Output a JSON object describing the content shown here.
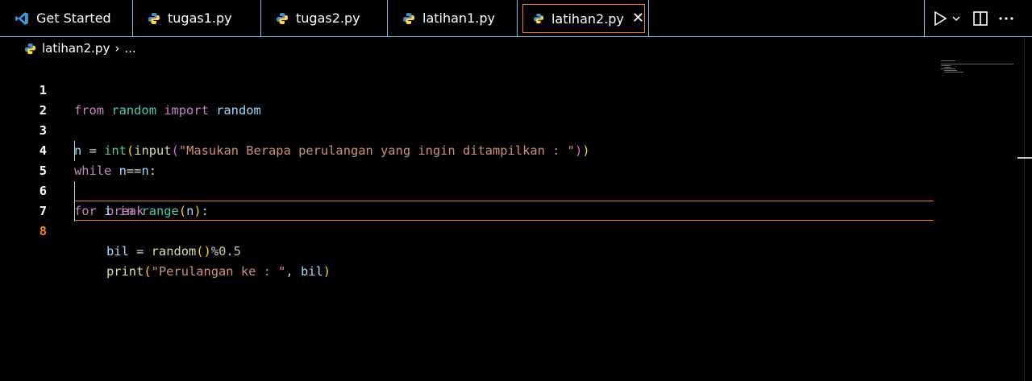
{
  "tabs": [
    {
      "label": "Get Started",
      "icon": "vscode-logo-icon"
    },
    {
      "label": "tugas1.py",
      "icon": "python-icon"
    },
    {
      "label": "tugas2.py",
      "icon": "python-icon"
    },
    {
      "label": "latihan1.py",
      "icon": "python-icon"
    },
    {
      "label": "latihan2.py",
      "icon": "python-icon",
      "active": true,
      "close": "✕"
    }
  ],
  "actions": {
    "run": "run-icon",
    "dropdown": "chevron-down-icon",
    "split": "split-editor-icon",
    "more": "more-icon"
  },
  "breadcrumb": {
    "file": "latihan2.py",
    "separator": "›",
    "rest": "..."
  },
  "editor": {
    "lines": [
      {
        "n": "1"
      },
      {
        "n": "2"
      },
      {
        "n": "3"
      },
      {
        "n": "4"
      },
      {
        "n": "5"
      },
      {
        "n": "6"
      },
      {
        "n": "7"
      },
      {
        "n": "8"
      }
    ],
    "code": {
      "l1": [
        "from",
        "random",
        "import",
        "random"
      ],
      "l3": [
        "n",
        "=",
        "int",
        "(",
        "input",
        "(",
        "\"Masukan Berapa perulangan yang ingin ditampilkan : \"",
        ")",
        ")"
      ],
      "l4": [
        "while",
        "n",
        "==",
        "n",
        ":"
      ],
      "l5": [
        "break"
      ],
      "l6": [
        "for",
        "i",
        "in",
        "range",
        "(",
        "n",
        ")",
        ":"
      ],
      "l7": [
        "bil",
        "=",
        "random",
        "()",
        "%",
        "0.5"
      ],
      "l8": [
        "print",
        "(",
        "\"Perulangan ke : \"",
        ",",
        "bil",
        ")"
      ]
    },
    "current_line": 8
  },
  "colors": {
    "accent": "#6fc3df",
    "focus": "#f38518",
    "background": "#000000"
  }
}
